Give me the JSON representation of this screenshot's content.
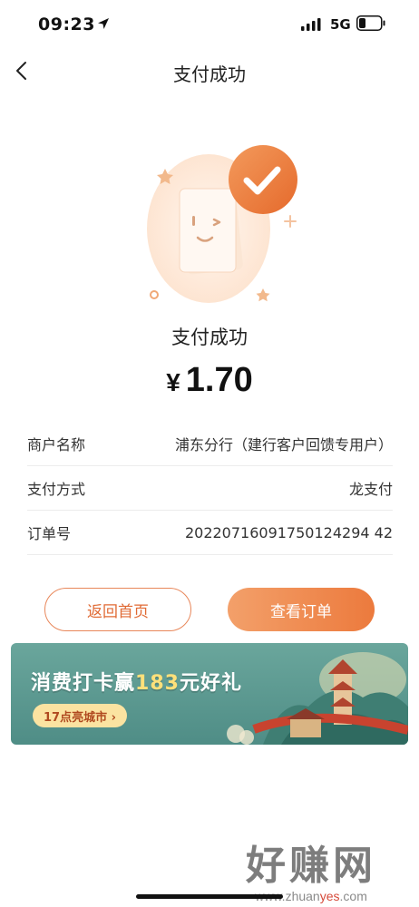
{
  "status": {
    "time": "09:23",
    "network": "5G"
  },
  "nav": {
    "title": "支付成功"
  },
  "result": {
    "title": "支付成功",
    "currency": "¥",
    "amount": "1.70"
  },
  "info": [
    {
      "label": "商户名称",
      "value": "浦东分行（建行客户回馈专用户）"
    },
    {
      "label": "支付方式",
      "value": "龙支付"
    },
    {
      "label": "订单号",
      "value": "20220716091750124294 42"
    }
  ],
  "buttons": {
    "home": "返回首页",
    "order": "查看订单"
  },
  "banner": {
    "title_prefix": "消费打卡赢",
    "title_highlight": "183",
    "title_suffix": "元好礼",
    "pill": "17点亮城市 ›"
  },
  "watermark": {
    "main": "好赚网",
    "domain_prefix": "www.zhuan",
    "domain_highlight": "yes",
    "domain_suffix": ".com"
  },
  "colors": {
    "accent": "#ec7a3d",
    "banner_bg": "#4f8d86"
  }
}
